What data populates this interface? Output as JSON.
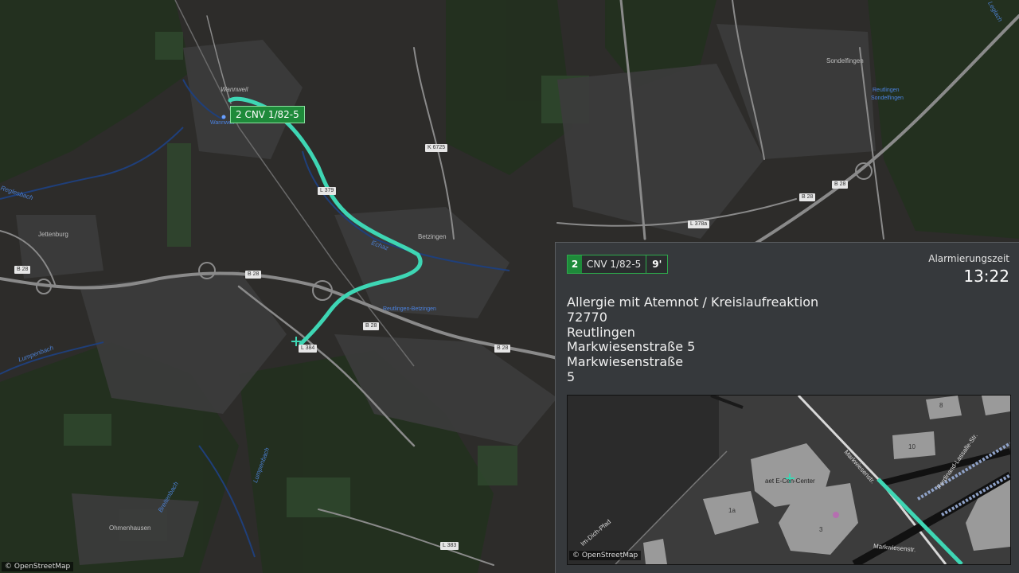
{
  "map": {
    "places": {
      "wannweil": "Wannweil",
      "wannweil_station": "Wannweil",
      "sondelfingen": "Sondelfingen",
      "reutlingen_sondelfingen_1": "Reutlingen",
      "reutlingen_sondelfingen_2": "Sondelfingen",
      "jettenburg": "Jettenburg",
      "betzingen": "Betzingen",
      "reutlingen_betzingen": "Reutlingen-Betzingen",
      "ohmenhausen": "Ohmenhausen"
    },
    "waters": {
      "reglesbach": "Reglesbach",
      "echaz": "Echaz",
      "lumpenbach": "Lumpenbach",
      "lumpenbach2": "Lumpenbach",
      "breitenbach": "Breitenbach",
      "leglach": "Leglach"
    },
    "roads": {
      "k6725": "K 6725",
      "l379": "L 379",
      "b28_a": "B 28",
      "b28_b": "B 28",
      "b28_c": "B 28",
      "b28_d": "B 28",
      "b28_e": "B 28",
      "b28_f": "B 28",
      "l378a": "L 378a",
      "l383": "L 383",
      "l384": "L 384"
    },
    "vehicle_label": "2 CNV 1/82-5",
    "attribution": "© OpenStreetMap",
    "route_color": "#3ed6b4"
  },
  "panel": {
    "unit": {
      "number": "2",
      "name": "CNV 1/82-5",
      "eta": "9'"
    },
    "alarm_label": "Alarmierungszeit",
    "alarm_time": "13:22",
    "incident": {
      "keyword": "Allergie mit Atemnot / Kreislaufreaktion",
      "postal_code": "72770",
      "city": "Reutlingen",
      "address": "Markwiesenstraße 5",
      "street": "Markwiesenstraße",
      "house_number": "5"
    },
    "minimap": {
      "street1": "Markwiesenstr.",
      "street2": "Ferdinand-Lassalle-Str.",
      "street3": "Markwiesenstr.",
      "path": "Im-Dich-Pfad",
      "poi": "aet E-Cen-Center",
      "house_8": "8",
      "house_10": "10",
      "house_1a": "1a",
      "house_3": "3",
      "attribution": "© OpenStreetMap"
    }
  },
  "colors": {
    "accent_green": "#1e8a3a",
    "panel_bg": "#36393c",
    "map_bg": "#2b2b2b"
  }
}
